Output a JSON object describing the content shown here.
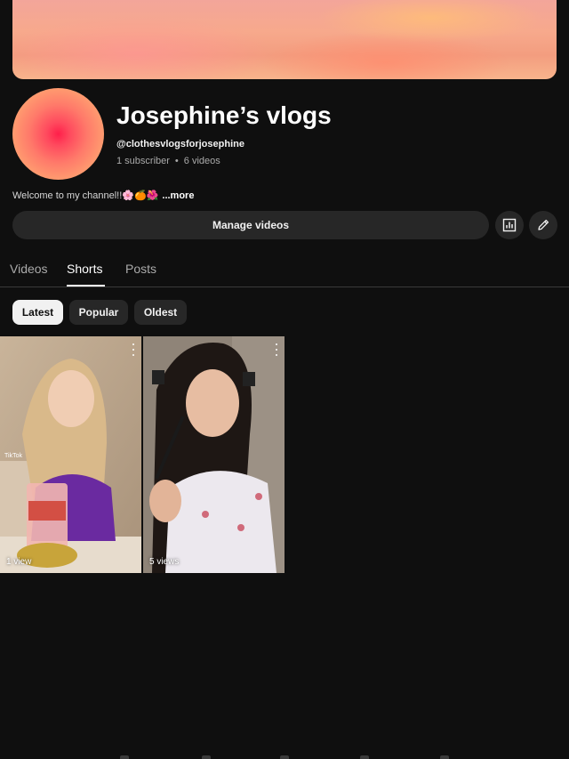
{
  "channel": {
    "title": "Josephine’s vlogs",
    "handle": "@clothesvlogsforjosephine",
    "subscribers": "1 subscriber",
    "videos": "6 videos",
    "description": "Welcome to my channel!!🌸🍊🌺",
    "more_label": "...more"
  },
  "actions": {
    "manage_label": "Manage videos",
    "analytics_icon": "analytics-icon",
    "edit_icon": "pencil-icon"
  },
  "tabs": [
    {
      "label": "Videos",
      "active": false
    },
    {
      "label": "Shorts",
      "active": true
    },
    {
      "label": "Posts",
      "active": false
    }
  ],
  "filters": [
    {
      "label": "Latest",
      "selected": true
    },
    {
      "label": "Popular",
      "selected": false
    },
    {
      "label": "Oldest",
      "selected": false
    }
  ],
  "shorts": [
    {
      "views": "1 view",
      "watermark": "TikTok"
    },
    {
      "views": "5 views"
    }
  ],
  "colors": {
    "background": "#0f0f0f",
    "button": "#272727",
    "chip_selected": "#f1f1f1"
  }
}
